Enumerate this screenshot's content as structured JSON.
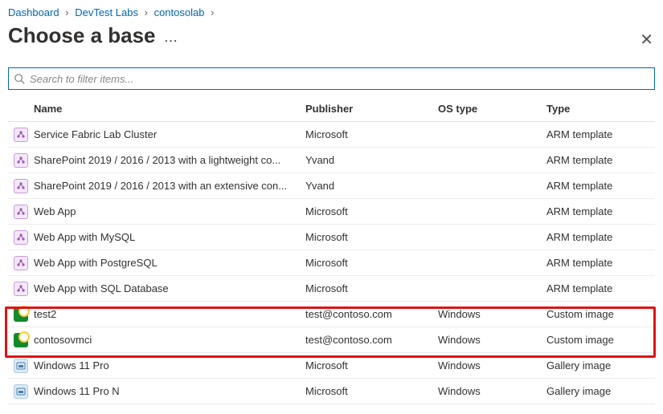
{
  "breadcrumb": {
    "items": [
      "Dashboard",
      "DevTest Labs",
      "contosolab"
    ]
  },
  "page_title": "Choose a base",
  "search": {
    "placeholder": "Search to filter items..."
  },
  "columns": {
    "name": "Name",
    "publisher": "Publisher",
    "os": "OS type",
    "type": "Type"
  },
  "rows": [
    {
      "iconKind": "arm",
      "name": "Service Fabric Lab Cluster",
      "publisher": "Microsoft",
      "os": "",
      "type": "ARM template"
    },
    {
      "iconKind": "arm",
      "name": "SharePoint 2019 / 2016 / 2013 with a lightweight co...",
      "publisher": "Yvand",
      "os": "",
      "type": "ARM template"
    },
    {
      "iconKind": "arm",
      "name": "SharePoint 2019 / 2016 / 2013 with an extensive con...",
      "publisher": "Yvand",
      "os": "",
      "type": "ARM template"
    },
    {
      "iconKind": "arm",
      "name": "Web App",
      "publisher": "Microsoft",
      "os": "",
      "type": "ARM template"
    },
    {
      "iconKind": "arm",
      "name": "Web App with MySQL",
      "publisher": "Microsoft",
      "os": "",
      "type": "ARM template"
    },
    {
      "iconKind": "arm",
      "name": "Web App with PostgreSQL",
      "publisher": "Microsoft",
      "os": "",
      "type": "ARM template"
    },
    {
      "iconKind": "arm",
      "name": "Web App with SQL Database",
      "publisher": "Microsoft",
      "os": "",
      "type": "ARM template"
    },
    {
      "iconKind": "custom",
      "name": "test2",
      "publisher": "test@contoso.com",
      "os": "Windows",
      "type": "Custom image"
    },
    {
      "iconKind": "custom",
      "name": "contosovmci",
      "publisher": "test@contoso.com",
      "os": "Windows",
      "type": "Custom image"
    },
    {
      "iconKind": "gallery",
      "name": "Windows 11 Pro",
      "publisher": "Microsoft",
      "os": "Windows",
      "type": "Gallery image"
    },
    {
      "iconKind": "gallery",
      "name": "Windows 11 Pro N",
      "publisher": "Microsoft",
      "os": "Windows",
      "type": "Gallery image"
    }
  ]
}
